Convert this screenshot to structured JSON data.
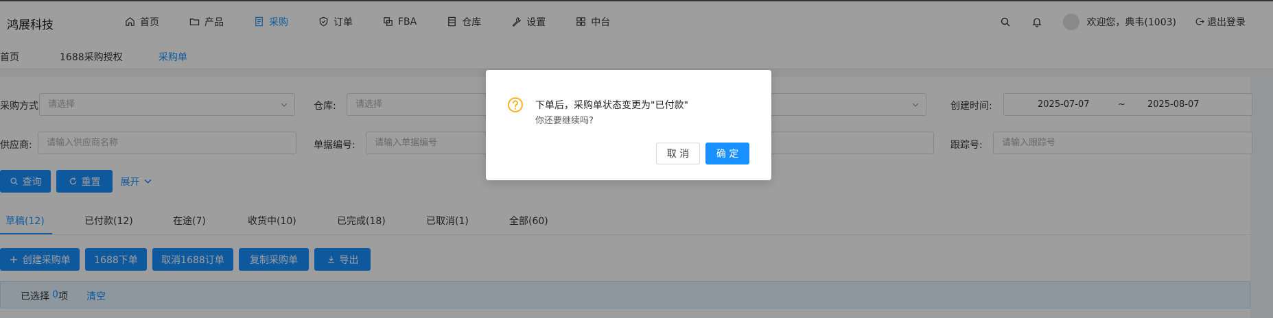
{
  "app": {
    "brand": "鸿展科技"
  },
  "nav": [
    {
      "label": "首页",
      "icon": "home-icon"
    },
    {
      "label": "产品",
      "icon": "folder-icon"
    },
    {
      "label": "采购",
      "icon": "purchase-icon",
      "active": true
    },
    {
      "label": "订单",
      "icon": "shield-check-icon"
    },
    {
      "label": "FBA",
      "icon": "copy-icon"
    },
    {
      "label": "仓库",
      "icon": "warehouse-icon"
    },
    {
      "label": "设置",
      "icon": "wrench-icon"
    },
    {
      "label": "中台",
      "icon": "grid-icon"
    }
  ],
  "header": {
    "user": "欢迎您，典韦(1003)",
    "logout": "退出登录"
  },
  "breadcrumb": [
    "首页",
    "1688采购授权",
    "采购单"
  ],
  "filters": {
    "purchase_method_label": "采购方式:",
    "purchase_method_placeholder": "请选择",
    "warehouse_label": "仓库:",
    "warehouse_placeholder": "请选择",
    "created_label": "创建时间:",
    "date_start": "2025-07-07",
    "date_sep": "~",
    "date_end": "2025-08-07",
    "supplier_label": "供应商:",
    "supplier_placeholder": "请输入供应商名称",
    "doc_no_label": "单据编号:",
    "doc_no_placeholder": "请输入单据编号",
    "tracking_label": "跟踪号:",
    "tracking_placeholder": "请输入跟踪号",
    "search_btn": "查询",
    "reset_btn": "重置",
    "expand": "展开"
  },
  "tabs": [
    "草稿(12)",
    "已付款(12)",
    "在途(7)",
    "收货中(10)",
    "已完成(18)",
    "已取消(1)",
    "全部(60)"
  ],
  "actions": {
    "create": "创建采购单",
    "order_1688": "1688下单",
    "cancel_1688": "取消1688订单",
    "copy": "复制采购单",
    "export": "导出"
  },
  "selection": {
    "prefix": "已选择",
    "count": "0",
    "suffix": "项",
    "clear": "清空"
  },
  "dialog": {
    "title": "下单后，采购单状态变更为\"已付款\"",
    "subtitle": "你还要继续吗?",
    "cancel": "取 消",
    "ok": "确 定"
  },
  "colors": {
    "primary": "#1890ff",
    "warning": "#faad14"
  }
}
